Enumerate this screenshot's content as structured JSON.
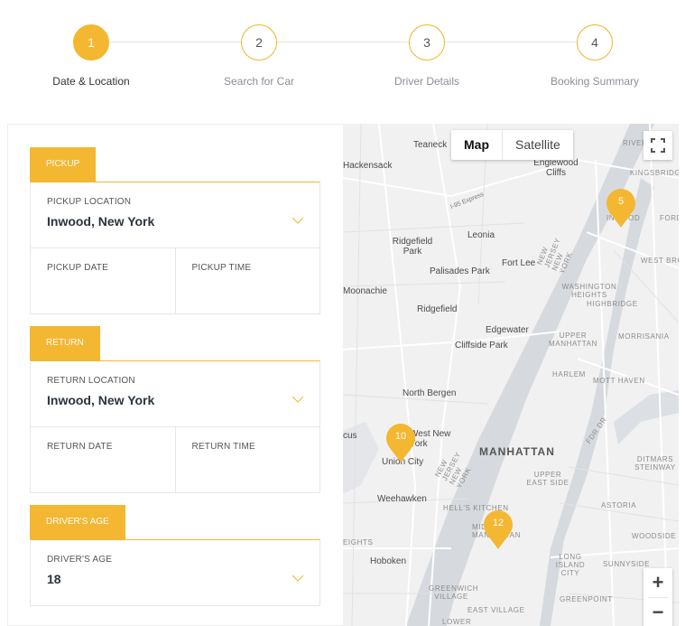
{
  "stepper": {
    "steps": [
      {
        "number": "1",
        "label": "Date & Location"
      },
      {
        "number": "2",
        "label": "Search for Car"
      },
      {
        "number": "3",
        "label": "Driver Details"
      },
      {
        "number": "4",
        "label": "Booking Summary"
      }
    ],
    "active_step": 1
  },
  "pickup": {
    "tab": "PICKUP",
    "location_label": "PICKUP LOCATION",
    "location_value": "Inwood, New York",
    "date_label": "PICKUP DATE",
    "time_label": "PICKUP TIME"
  },
  "return": {
    "tab": "RETURN",
    "location_label": "RETURN LOCATION",
    "location_value": "Inwood, New York",
    "date_label": "RETURN DATE",
    "time_label": "RETURN TIME"
  },
  "driver": {
    "tab": "DRIVER'S AGE",
    "age_label": "DRIVER'S AGE",
    "age_value": "18"
  },
  "map": {
    "map_button": "Map",
    "satellite_button": "Satellite",
    "zoom_in": "+",
    "zoom_out": "−",
    "markers": [
      "5",
      "10",
      "12"
    ],
    "labels": {
      "teaneck": "Teaneck",
      "hackensack": "Hackensack",
      "englewood_cliffs": "Englewood Cliffs",
      "i95": "I-95 Express",
      "leonia": "Leonia",
      "ridgefield_park": "Ridgefield Park",
      "fort_lee": "Fort Lee",
      "palisades_park": "Palisades Park",
      "moonachie": "Moonachie",
      "ridgefield": "Ridgefield",
      "edgewater": "Edgewater",
      "cliffside_park": "Cliffside Park",
      "north_bergen": "North Bergen",
      "west_new_york": "West New York",
      "union_city": "Union City",
      "weehawken": "Weehawken",
      "hoboken": "Hoboken",
      "manhattan": "MANHATTAN",
      "nj_ny_1": "NEW JERSEY NEW YORK",
      "nj_ny_2": "NEW JERSEY NEW YORK",
      "fdr": "FDR Dr",
      "river": "RIVER",
      "kingsbridge": "KINGSBRIDGE",
      "inwood": "INWOOD",
      "fordham": "FORDHAM",
      "west_bronx": "WEST BRONX",
      "washington_heights": "WASHINGTON HEIGHTS",
      "highbridge": "HIGHBRIDGE",
      "upper_manhattan": "UPPER MANHATTAN",
      "morrisania": "MORRISANIA",
      "harlem": "HARLEM",
      "mott_haven": "MOTT HAVEN",
      "ditmars": "DITMARS STEINWAY",
      "upper_east_side": "UPPER EAST SIDE",
      "hells_kitchen": "HELL'S KITCHEN",
      "astoria": "ASTORIA",
      "midtown": "MIDTOWN MANHATTAN",
      "heights": "EIGHTS",
      "woodside": "WOODSIDE",
      "long_island_city": "LONG ISLAND CITY",
      "sunnyside": "SUNNYSIDE",
      "greenwich": "GREENWICH VILLAGE",
      "east_village": "EAST VILLAGE",
      "greenpoint": "GREENPOINT",
      "lower": "LOWER",
      "cus": "cus"
    }
  },
  "colors": {
    "accent": "#f3b731",
    "water": "#d6d9dd",
    "land": "#f1f1f1"
  }
}
